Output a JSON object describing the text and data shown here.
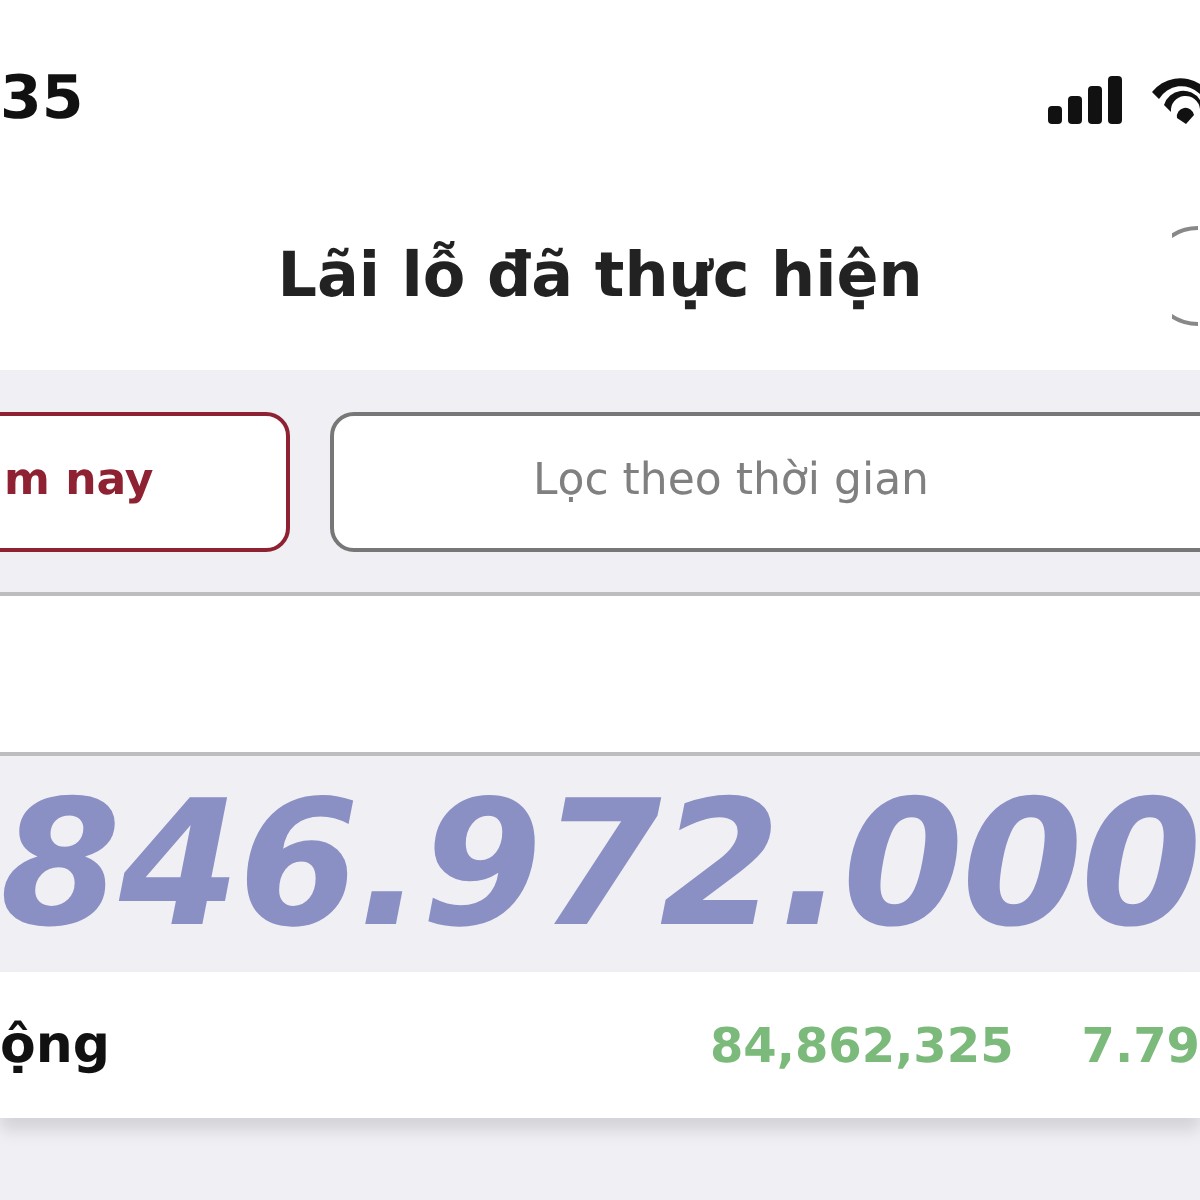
{
  "status_bar": {
    "time": "35"
  },
  "header": {
    "title": "Lãi lỗ đã thực hiện"
  },
  "filters": [
    {
      "label": "m nay",
      "selected": true
    },
    {
      "label": "Lọc theo thời gian",
      "selected": false
    }
  ],
  "total": {
    "value": "846.972.000"
  },
  "rows": [
    {
      "label": "ộng",
      "amount": "84,862,325",
      "percent": "7.79"
    }
  ]
}
